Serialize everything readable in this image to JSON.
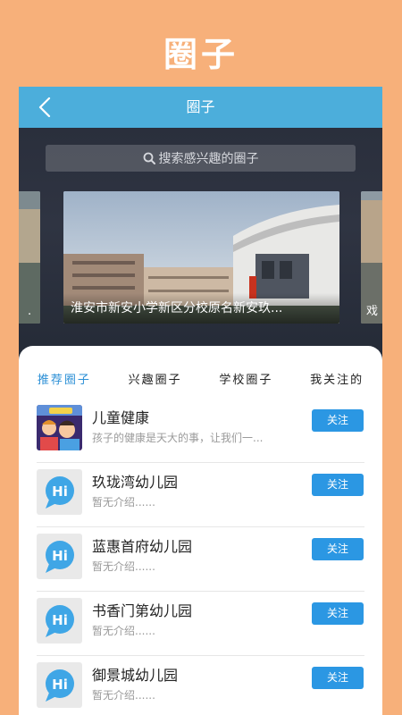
{
  "promo": {
    "title": "圈子"
  },
  "header": {
    "title": "圈子",
    "back_icon": "chevron-left-icon"
  },
  "search": {
    "placeholder": "搜索感兴趣的圈子",
    "icon": "search-icon"
  },
  "banner": {
    "main_caption": "淮安市新安小学新区分校原名新安玖...",
    "right_caption": "戏",
    "left_caption": "."
  },
  "tabs": [
    {
      "label": "推荐圈子",
      "active": true
    },
    {
      "label": "兴趣圈子",
      "active": false
    },
    {
      "label": "学校圈子",
      "active": false
    },
    {
      "label": "我关注的",
      "active": false
    }
  ],
  "circles": [
    {
      "name": "儿童健康",
      "desc": "孩子的健康是天大的事，让我们一...",
      "button": "关注",
      "avatar": "kids-health-image"
    },
    {
      "name": "玖珑湾幼儿园",
      "desc": "暂无介绍......",
      "button": "关注",
      "avatar": "hi-bubble-icon"
    },
    {
      "name": "蓝惠首府幼儿园",
      "desc": "暂无介绍......",
      "button": "关注",
      "avatar": "hi-bubble-icon"
    },
    {
      "name": "书香门第幼儿园",
      "desc": "暂无介绍......",
      "button": "关注",
      "avatar": "hi-bubble-icon"
    },
    {
      "name": "御景城幼儿园",
      "desc": "暂无介绍......",
      "button": "关注",
      "avatar": "hi-bubble-icon"
    }
  ],
  "colors": {
    "background": "#F7B07A",
    "header": "#4CAEDB",
    "accent": "#2B97E3"
  }
}
